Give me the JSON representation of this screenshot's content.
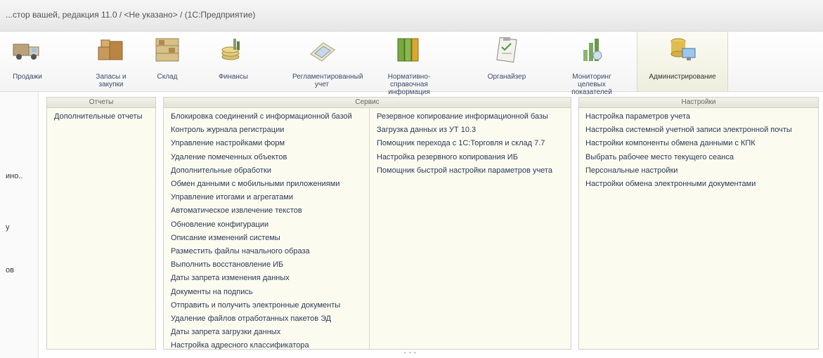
{
  "window": {
    "title": "...стор вашей, редакция 11.0 / <Не указано> / (1С:Предприятие)"
  },
  "sections": [
    {
      "label": "Продажи",
      "icon": "truck-icon"
    },
    {
      "label": "Запасы и закупки",
      "icon": "boxes-icon"
    },
    {
      "label": "Склад",
      "icon": "warehouse-icon"
    },
    {
      "label": "Финансы",
      "icon": "coins-icon"
    },
    {
      "label": "Регламентированный учет",
      "icon": "calculator-icon"
    },
    {
      "label": "Нормативно-справочная информация",
      "icon": "binders-icon"
    },
    {
      "label": "Органайзер",
      "icon": "clipboard-icon"
    },
    {
      "label": "Мониторинг целевых показателей",
      "icon": "chart-icon"
    },
    {
      "label": "Администрирование",
      "icon": "database-computer-icon"
    }
  ],
  "left_panel": {
    "fragments": [
      "ино..",
      "у",
      "ов"
    ]
  },
  "reports": {
    "title": "Отчеты",
    "items": [
      "Дополнительные отчеты"
    ]
  },
  "service": {
    "title": "Сервис",
    "col1": [
      "Блокировка соединений с информационной базой",
      "Контроль журнала регистрации",
      "Управление настройками форм",
      "Удаление помеченных объектов",
      "Дополнительные обработки",
      "Обмен данными с мобильными приложениями",
      "Управление итогами и агрегатами",
      "Автоматическое извлечение текстов",
      "Обновление конфигурации",
      "Описание изменений системы",
      "Разместить файлы начального образа",
      "Выполнить восстановление ИБ",
      "Даты запрета изменения данных",
      "Документы на подпись",
      "Отправить и получить электронные документы",
      "Удаление файлов отработанных пакетов ЭД",
      "Даты запрета загрузки данных",
      "Настройка адресного классификатора"
    ],
    "col2": [
      "Резервное копирование информационной базы",
      "Загрузка данных из УТ 10.3",
      "Помощник перехода с 1С:Торговля и склад 7.7",
      "Настройка резервного копирования ИБ",
      "Помощник быстрой настройки параметров учета"
    ]
  },
  "settings": {
    "title": "Настройки",
    "items": [
      "Настройка параметров учета",
      "Настройка системной учетной записи электронной почты",
      "Настройки компоненты обмена данными с КПК",
      "Выбрать рабочее место текущего сеанса",
      "Персональные настройки",
      "Настройки обмена электронными документами"
    ]
  },
  "bottom": {
    "resize_dots": "• • •"
  },
  "colors": {
    "panel_bg": "#fbfbf0",
    "link": "#2b3a55",
    "active_section_bg": "#eeeedd"
  }
}
